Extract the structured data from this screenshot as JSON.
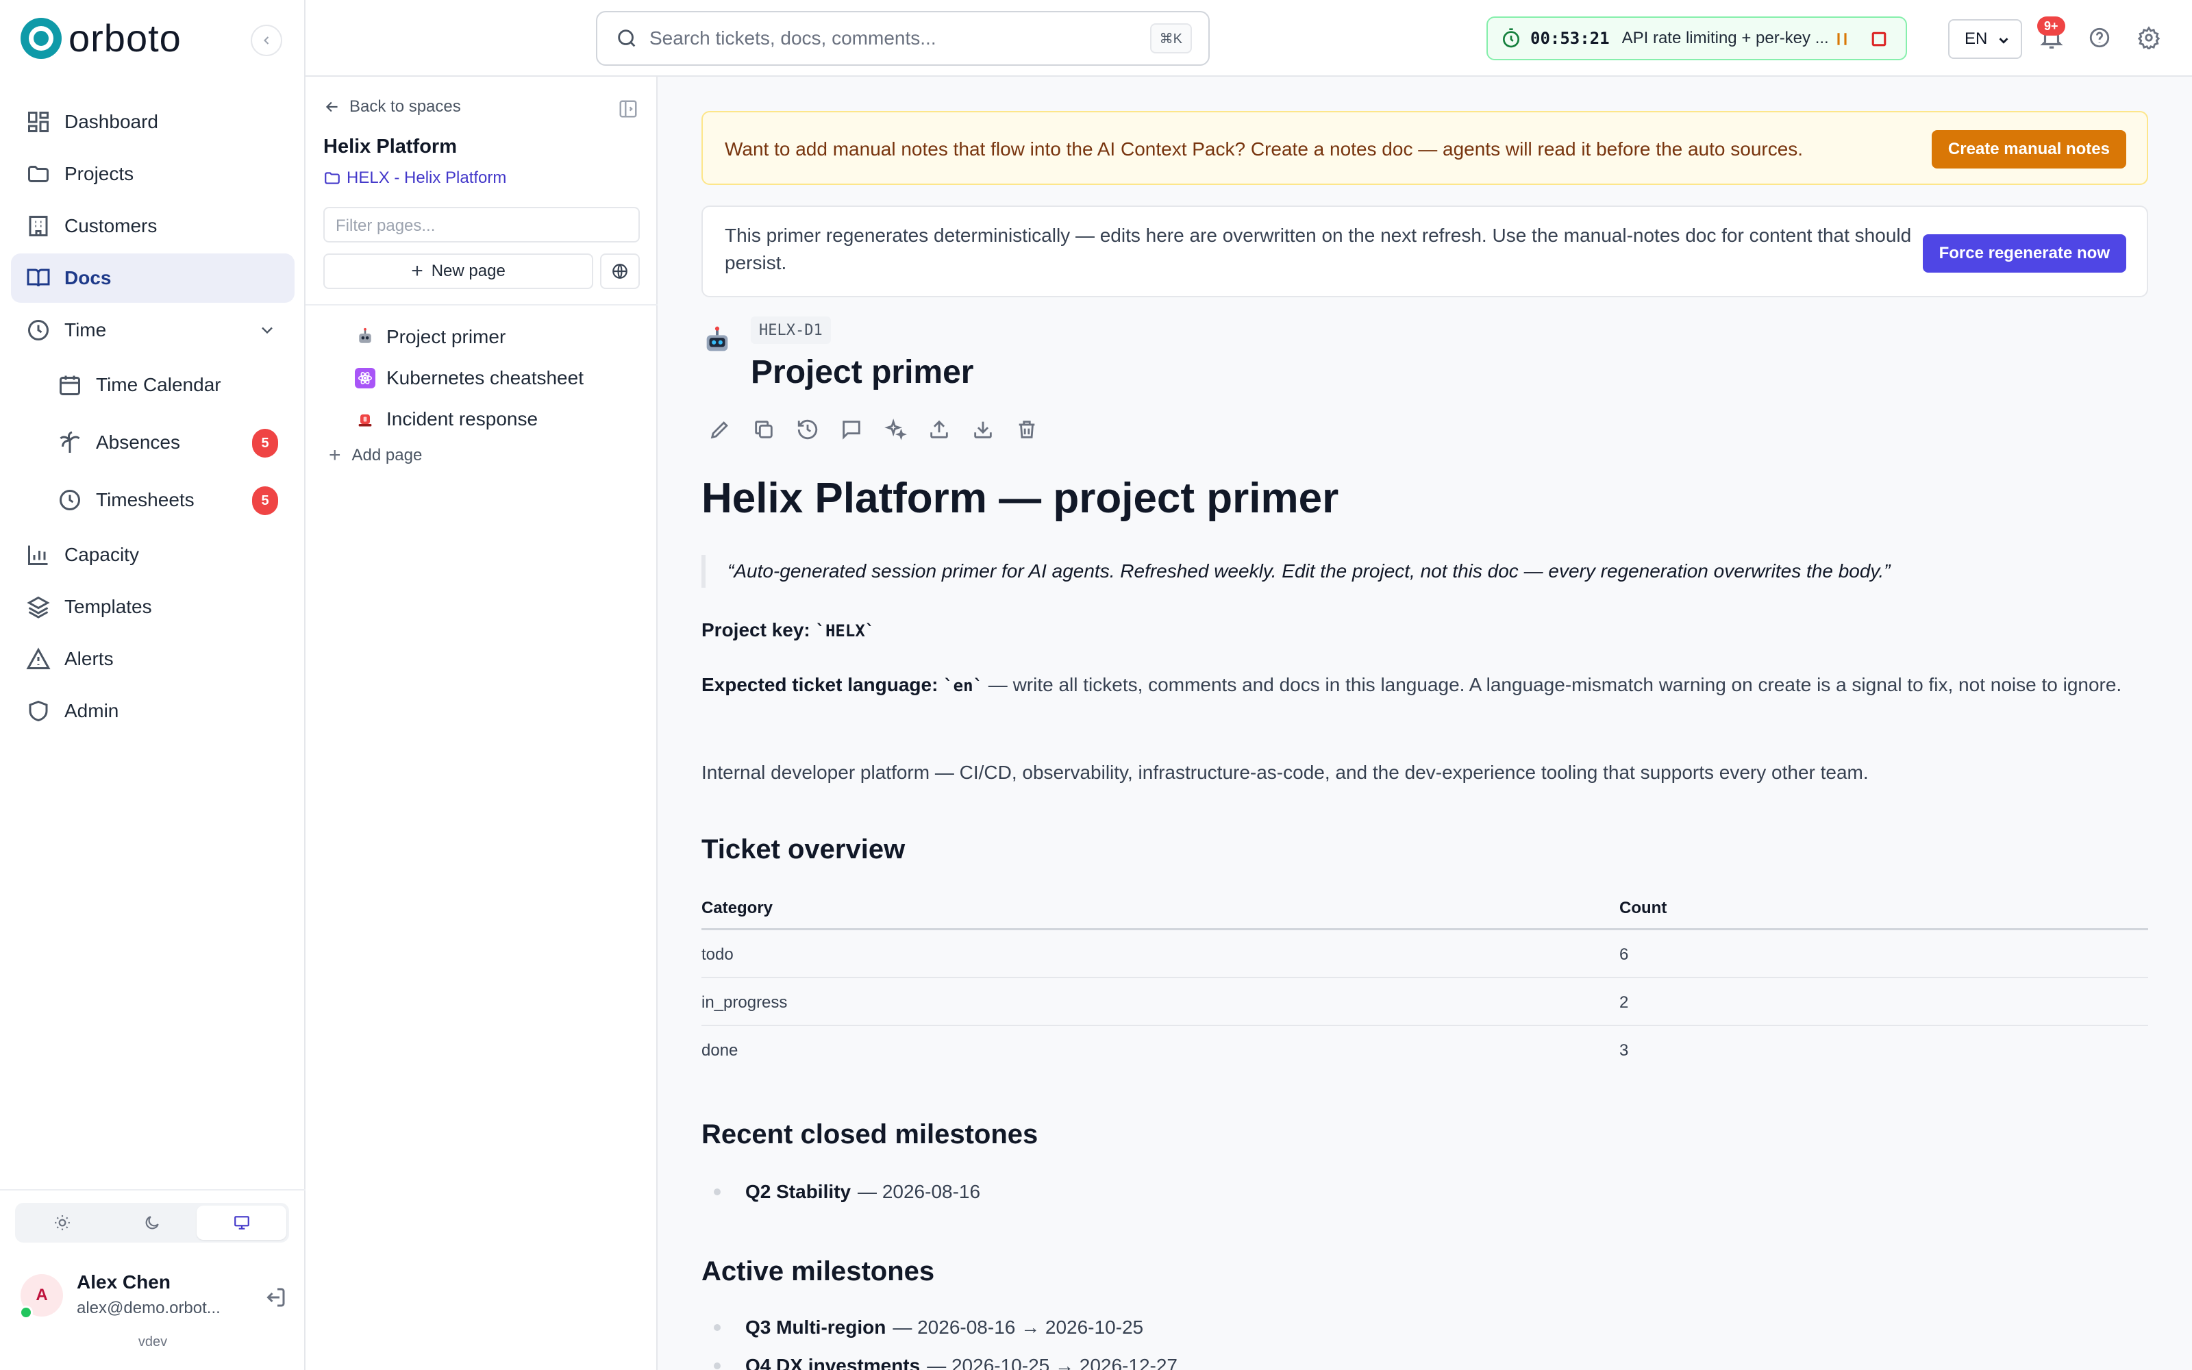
{
  "app": {
    "logo_text": "orboto",
    "version": "vdev"
  },
  "sidebar": {
    "items": [
      {
        "label": "Dashboard",
        "icon": "dashboard-icon"
      },
      {
        "label": "Projects",
        "icon": "folder-icon"
      },
      {
        "label": "Customers",
        "icon": "building-icon"
      },
      {
        "label": "Docs",
        "icon": "book-icon",
        "active": true
      },
      {
        "label": "Time",
        "icon": "clock-icon",
        "expanded": true
      },
      {
        "label": "Time Calendar",
        "icon": "calendar-icon"
      },
      {
        "label": "Absences",
        "icon": "palm-tree-icon",
        "badge": "5"
      },
      {
        "label": "Timesheets",
        "icon": "clock-icon",
        "badge": "5"
      },
      {
        "label": "Capacity",
        "icon": "bar-chart-icon"
      },
      {
        "label": "Templates",
        "icon": "layers-icon"
      },
      {
        "label": "Alerts",
        "icon": "alert-triangle-icon"
      },
      {
        "label": "Admin",
        "icon": "shield-icon"
      }
    ],
    "theme_options": [
      "light",
      "dark",
      "system"
    ],
    "theme_selected": "system",
    "user": {
      "initial": "A",
      "name": "Alex Chen",
      "email": "alex@demo.orbot..."
    }
  },
  "tree": {
    "back_label": "Back to spaces",
    "space_title": "Helix Platform",
    "space_link": "HELX - Helix Platform",
    "filter_placeholder": "Filter pages...",
    "new_page_label": "New page",
    "pages": [
      {
        "label": "Project primer",
        "icon": "robot-icon"
      },
      {
        "label": "Kubernetes cheatsheet",
        "icon": "atom-icon"
      },
      {
        "label": "Incident response",
        "icon": "siren-icon"
      }
    ],
    "add_page_label": "Add page"
  },
  "topbar": {
    "search_placeholder": "Search tickets, docs, comments...",
    "search_shortcut": "⌘K",
    "timer": {
      "time": "00:53:21",
      "label": "API rate limiting + per-key ..."
    },
    "language": "EN",
    "notifications_badge": "9+"
  },
  "main": {
    "warn_banner": {
      "text": "Want to add manual notes that flow into the AI Context Pack? Create a notes doc — agents will read it before the auto sources.",
      "button": "Create manual notes"
    },
    "info_banner": {
      "text": "This primer regenerates deterministically — edits here are overwritten on the next refresh. Use the manual-notes doc for content that should persist.",
      "button": "Force regenerate now"
    },
    "doc": {
      "key": "HELX-D1",
      "title": "Project primer",
      "tools": [
        "pencil-icon",
        "copy-icon",
        "history-icon",
        "comment-icon",
        "sparkles-icon",
        "upload-icon",
        "download-icon",
        "trash-icon"
      ]
    },
    "body": {
      "h1": "Helix Platform — project primer",
      "quote": "“Auto-generated session primer for AI agents. Refreshed weekly. Edit the project, not this doc — every regeneration overwrites the body.”",
      "project_key_label": "Project key:",
      "project_key_value": "`HELX`",
      "language_label": "Expected ticket language:",
      "language_value": "`en`",
      "language_text": " — write all tickets, comments and docs in this language. A language-mismatch warning on create is a signal to fix, not noise to ignore.",
      "description": "Internal developer platform — CI/CD, observability, infrastructure-as-code, and the dev-experience tooling that supports every other team.",
      "ticket_overview_heading": "Ticket overview",
      "table": {
        "headers": [
          "Category",
          "Count"
        ],
        "rows": [
          [
            "todo",
            "6"
          ],
          [
            "in_progress",
            "2"
          ],
          [
            "done",
            "3"
          ]
        ]
      },
      "closed_heading": "Recent closed milestones",
      "closed": [
        {
          "name": "Q2 Stability",
          "detail": "— 2026-08-16"
        }
      ],
      "active_heading": "Active milestones",
      "active": [
        {
          "name": "Q3 Multi-region",
          "detail": "— 2026-08-16 → 2026-10-25"
        },
        {
          "name": "Q4 DX investments",
          "detail": "— 2026-10-25 → 2026-12-27"
        }
      ]
    }
  }
}
